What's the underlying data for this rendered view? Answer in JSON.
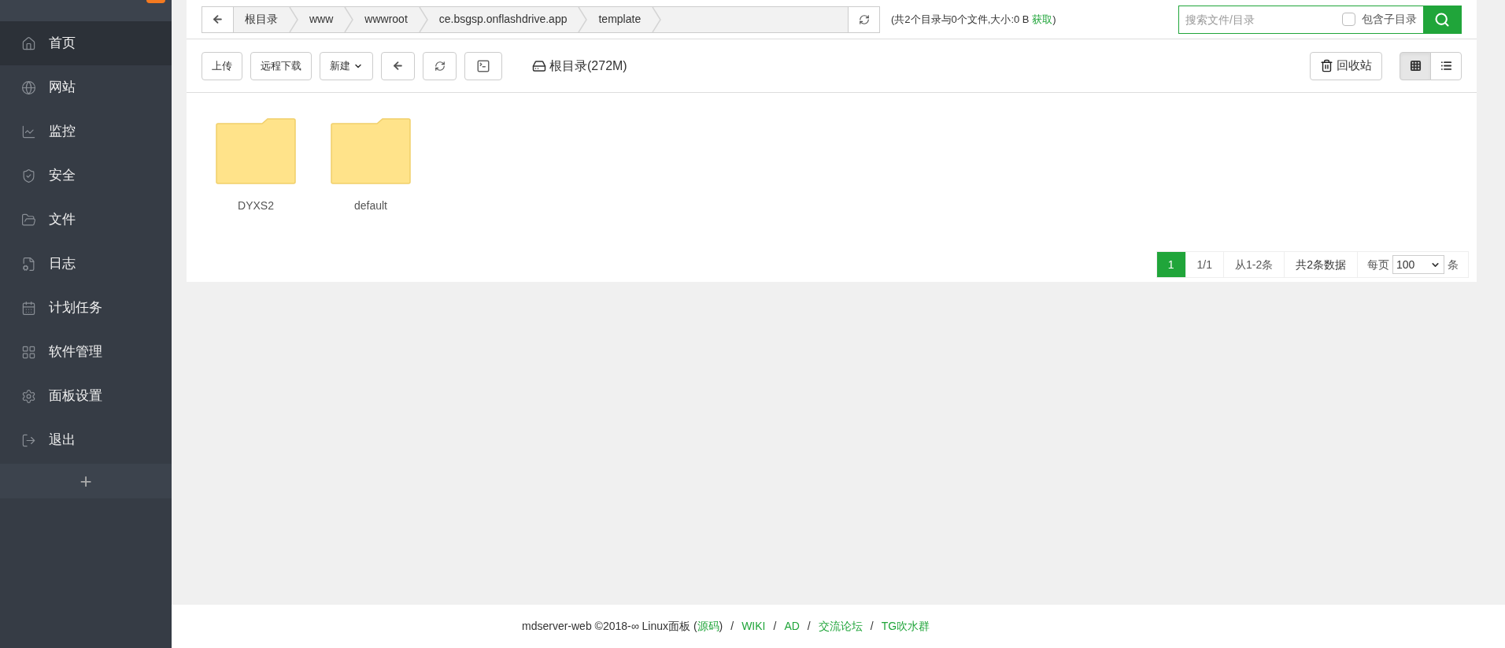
{
  "sidebar": {
    "items": [
      {
        "label": "首页",
        "selected": true
      },
      {
        "label": "网站",
        "selected": false
      },
      {
        "label": "监控",
        "selected": false
      },
      {
        "label": "安全",
        "selected": false
      },
      {
        "label": "文件",
        "selected": false
      },
      {
        "label": "日志",
        "selected": false
      },
      {
        "label": "计划任务",
        "selected": false
      },
      {
        "label": "软件管理",
        "selected": false
      },
      {
        "label": "面板设置",
        "selected": false
      },
      {
        "label": "退出",
        "selected": false
      }
    ],
    "add_label": "+"
  },
  "breadcrumb": [
    "根目录",
    "www",
    "wwwroot",
    "ce.bsgsp.onflashdrive.app",
    "template"
  ],
  "summary": {
    "prefix": "(共2个目录与0个文件,大小:0 B ",
    "link": "获取",
    "suffix": ")"
  },
  "search": {
    "placeholder": "搜索文件/目录",
    "include_subdirs": {
      "label": "包含子目录",
      "checked": false
    }
  },
  "toolbar": {
    "buttons": [
      "上传",
      "远程下载",
      "新建"
    ],
    "disk_label": "根目录(272M)",
    "recycle_label": "回收站",
    "view_modes": [
      {
        "kind": "grid",
        "selected": true
      },
      {
        "kind": "list",
        "selected": false
      }
    ]
  },
  "folders": [
    {
      "name": "DYXS2"
    },
    {
      "name": "default"
    }
  ],
  "pagination": {
    "pages": [
      {
        "label": "1",
        "selected": true
      }
    ],
    "page_of": "1/1",
    "range": "从1-2条",
    "total": "共2条数据",
    "per_page_label": "每页",
    "per_page": "100",
    "per_page_unit": "条"
  },
  "footer": [
    {
      "kind": "text",
      "text": "mdserver-web ©2018-∞ Linux面板 ("
    },
    {
      "kind": "link",
      "text": "源码"
    },
    {
      "kind": "text",
      "text": ")"
    },
    {
      "kind": "sep",
      "text": "/"
    },
    {
      "kind": "link",
      "text": "WIKI"
    },
    {
      "kind": "sep",
      "text": "/"
    },
    {
      "kind": "link",
      "text": "AD"
    },
    {
      "kind": "sep",
      "text": "/"
    },
    {
      "kind": "link",
      "text": "交流论坛"
    },
    {
      "kind": "sep",
      "text": "/"
    },
    {
      "kind": "link",
      "text": "TG吹水群"
    }
  ]
}
